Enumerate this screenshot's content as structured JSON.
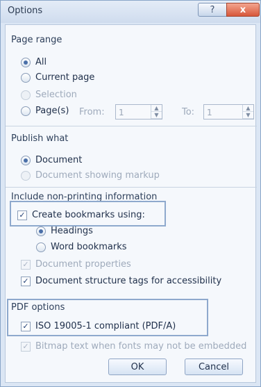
{
  "window": {
    "title": "Options",
    "help_label": "?",
    "close_label": "x"
  },
  "page_range": {
    "title": "Page range",
    "all": "All",
    "current": "Current page",
    "selection": "Selection",
    "pages": "Page(s)",
    "from_label": "From:",
    "from_value": "1",
    "to_label": "To:",
    "to_value": "1"
  },
  "publish_what": {
    "title": "Publish what",
    "document": "Document",
    "markup": "Document showing markup"
  },
  "non_printing": {
    "title": "Include non-printing information",
    "create_bookmarks": "Create bookmarks using:",
    "headings": "Headings",
    "word_bookmarks": "Word bookmarks",
    "doc_properties": "Document properties",
    "structure_tags": "Document structure tags for accessibility"
  },
  "pdf_options": {
    "title": "PDF options",
    "iso": "ISO 19005-1 compliant (PDF/A)",
    "bitmap": "Bitmap text when fonts may not be embedded"
  },
  "buttons": {
    "ok": "OK",
    "cancel": "Cancel"
  }
}
